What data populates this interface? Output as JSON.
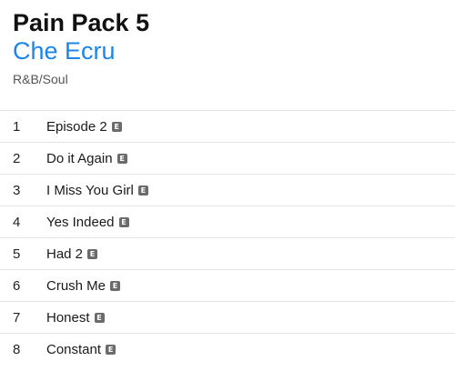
{
  "album": {
    "title": "Pain Pack 5",
    "artist": "Che Ecru",
    "genre": "R&B/Soul"
  },
  "explicit_badge": "E",
  "tracks": [
    {
      "number": "1",
      "name": "Episode 2",
      "explicit": true
    },
    {
      "number": "2",
      "name": "Do it Again",
      "explicit": true
    },
    {
      "number": "3",
      "name": "I Miss You Girl",
      "explicit": true
    },
    {
      "number": "4",
      "name": "Yes Indeed",
      "explicit": true
    },
    {
      "number": "5",
      "name": "Had 2",
      "explicit": true
    },
    {
      "number": "6",
      "name": "Crush Me",
      "explicit": true
    },
    {
      "number": "7",
      "name": "Honest",
      "explicit": true
    },
    {
      "number": "8",
      "name": "Constant",
      "explicit": true
    }
  ],
  "colors": {
    "artist_link": "#1c86e8",
    "explicit_badge_bg": "#6b6b6b",
    "row_divider": "#e4e4e4"
  }
}
